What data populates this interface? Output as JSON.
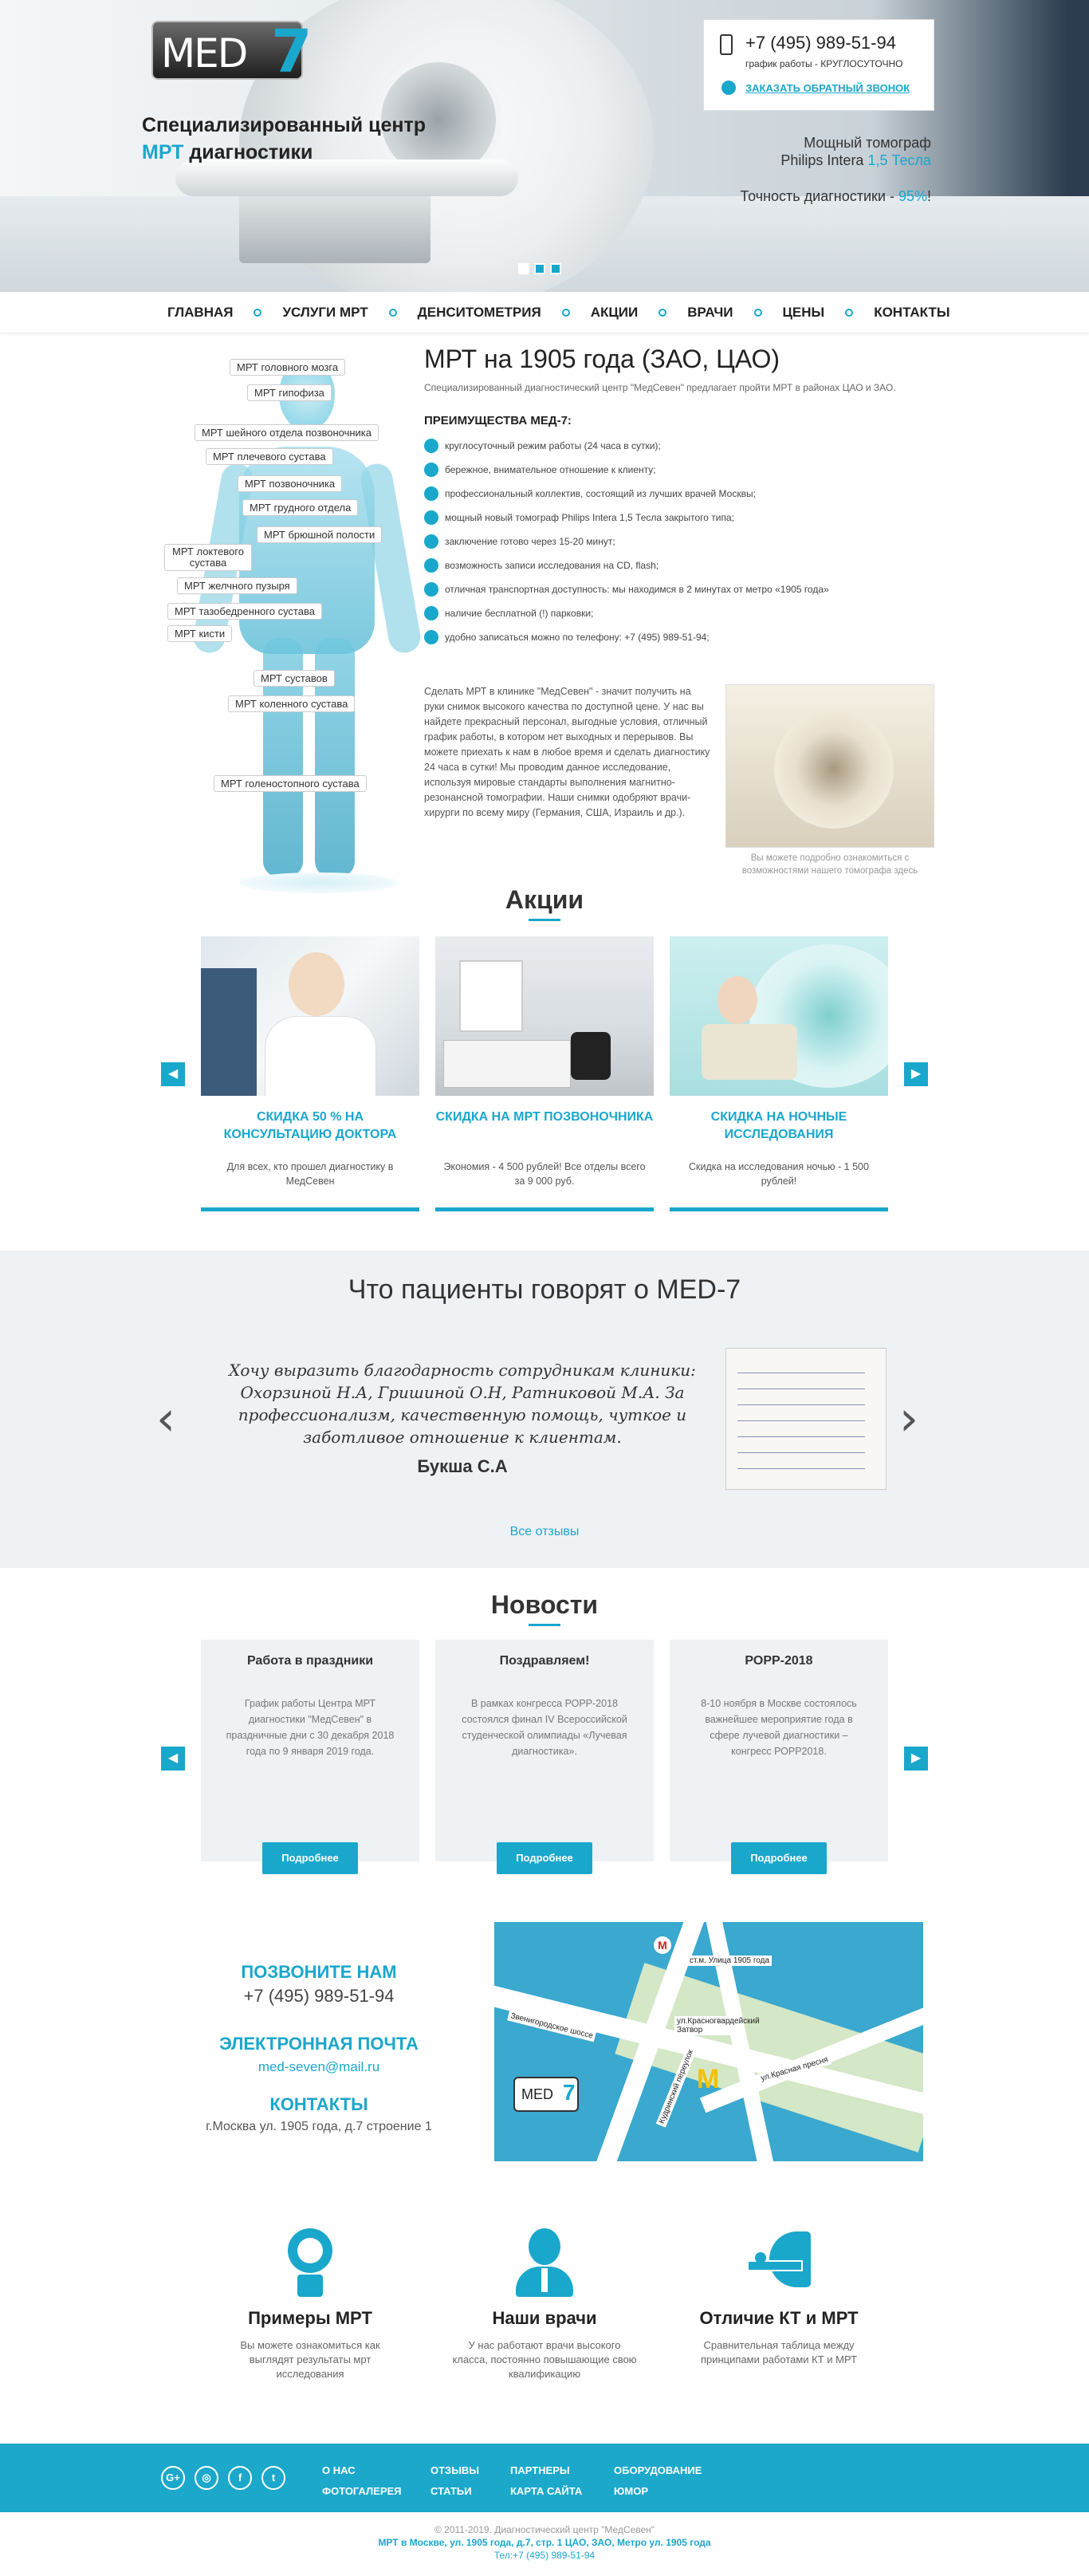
{
  "hero": {
    "logo_text": "MED",
    "logo_num": "7",
    "title_line1": "Специализированный центр",
    "title_accent": "МРТ",
    "title_line2_rest": " диагностики",
    "phone": "+7 (495) 989-51-94",
    "schedule": "график работы - КРУГЛОСУТОЧНО",
    "callback": "ЗАКАЗАТЬ ОБРАТНЫЙ ЗВОНОК",
    "tomograph_line1": "Мощный томограф",
    "tomograph_line2_model": "Philips Intera ",
    "tomograph_line2_accent": "1,5 Тесла",
    "accuracy_label": "Точность диагностики - ",
    "accuracy_value": "95%",
    "accuracy_suffix": "!"
  },
  "nav": [
    "ГЛАВНАЯ",
    "УСЛУГИ МРТ",
    "ДЕНСИТОМЕТРИЯ",
    "АКЦИИ",
    "ВРАЧИ",
    "ЦЕНЫ",
    "КОНТАКТЫ"
  ],
  "body_tags": [
    "МРТ головного мозга",
    "МРТ гипофиза",
    "МРТ шейного отдела позвоночника",
    "МРТ плечевого сустава",
    "МРТ позвоночника",
    "МРТ грудного отдела",
    "МРТ брюшной полости",
    "МРТ локтевого сустава",
    "МРТ желчного пузыря",
    "МРТ тазобедренного сустава",
    "МРТ кисти",
    "МРТ суставов",
    "МРТ коленного сустава",
    "МРТ голеностопного сустава"
  ],
  "intro": {
    "title": "МРТ на 1905 года (ЗАО, ЦАО)",
    "lead": "Специализированный диагностический центр \"МедСевен\" предлагает пройти МРТ в районах ЦАО и ЗАО.",
    "adv_title": "ПРЕИМУЩЕСТВА МЕД-7:",
    "advantages": [
      "круглосуточный режим работы (24 часа в сутки);",
      "бережное, внимательное отношение к клиенту;",
      "профессиональный коллектив, состоящий из лучших врачей Москвы;",
      "мощный новый томограф Philips Intera 1,5 Тесла закрытого типа;",
      "заключение готово через 15-20 минут;",
      "возможность записи исследования на CD, flash;",
      "отличная транспортная доступность: мы находимся в 2 минутах от метро «1905 года»",
      "наличие бесплатной (!) парковки;",
      "удобно записаться можно по телефону: +7 (495) 989-51-94;"
    ],
    "text": "Сделать МРТ в клинике \"МедСевен\" - значит получить на руки снимок высокого качества по доступной цене. У нас вы найдете прекрасный персонал, выгодные условия, отличный график работы, в котором нет выходных и перерывов. Вы можете приехать к нам в любое время и сделать диагностику 24 часа в сутки! Мы проводим данное исследование, используя мировые стандарты выполнения магнитно-резонансной томографии. Наши снимки одобряют врачи-хирурги по всему миру (Германия, США, Израиль и др.).",
    "caption": "Вы можете подробно ознакомиться с возможностями нашего томографа здесь"
  },
  "promos": {
    "title": "Акции",
    "items": [
      {
        "title": "СКИДКА 50 % НА КОНСУЛЬТАЦИЮ ДОКТОРА",
        "text": "Для всех, кто прошел диагностику в МедСевен"
      },
      {
        "title": "СКИДКА НА МРТ ПОЗВОНОЧНИКА",
        "text": "Экономия - 4 500 рублей! Все отделы всего за 9 000 руб."
      },
      {
        "title": "СКИДКА НА НОЧНЫЕ ИССЛЕДОВАНИЯ",
        "text": "Скидка на исследования ночью - 1 500 рублей!"
      }
    ]
  },
  "reviews": {
    "title": "Что пациенты говорят о MED-7",
    "quote": "Хочу выразить благодарность сотрудникам клиники: Охорзиной Н.А, Гришиной О.Н, Ратниковой М.А. За профессионализм, качественную помощь, чуткое и заботливое отношение к клиентам.",
    "author": "Букша С.А",
    "all_link": "Все отзывы"
  },
  "news": {
    "title": "Новости",
    "items": [
      {
        "title": "Работа в праздники",
        "text": "График работы Центра МРТ диагностики \"МедСевен\" в праздничные дни с 30 декабря 2018 года по 9 января 2019 года."
      },
      {
        "title": "Поздравляем!",
        "text": "В рамках конгресса РОРР-2018 состоялся финал IV Всероссийской студенческой олимпиады «Лучевая диагностика»."
      },
      {
        "title": "РОРР-2018",
        "text": "8-10 ноября в Москве состоялось важнейшее мероприятие года в сфере лучевой диагностики – конгресс РОРР2018."
      }
    ],
    "more": "Подробнее"
  },
  "contacts": {
    "call_label": "ПОЗВОНИТЕ НАМ",
    "phone": "+7 (495) 989-51-94",
    "email_label": "ЭЛЕКТРОННАЯ ПОЧТА",
    "email": "med-seven@mail.ru",
    "contacts_label": "КОНТАКТЫ",
    "address": "г.Москва ул. 1905 года, д.7 строение 1",
    "map_labels": [
      "ст.м. Улица 1905 года",
      "Звенигородское шоссе",
      "ул.Красногвардейский Затвор",
      "ул.Красная пресня",
      "Кудринский переулок"
    ],
    "map_logo": "MED"
  },
  "features": [
    {
      "title": "Примеры МРТ",
      "text": "Вы можете ознакомиться как выглядят результаты мрт исследования"
    },
    {
      "title": "Наши врачи",
      "text": "У нас работают врачи высокого класса, постоянно повышающие свою квалификацию"
    },
    {
      "title": "Отличие КТ и МРТ",
      "text": "Сравнительная таблица между принципами работами КТ и МРТ"
    }
  ],
  "footer": {
    "social": [
      "G+",
      "◎",
      "f",
      "t"
    ],
    "links": [
      "О НАС",
      "ФОТОГАЛЕРЕЯ",
      "ОТЗЫВЫ",
      "СТАТЬИ",
      "ПАРТНЕРЫ",
      "КАРТА САЙТА",
      "ОБОРУДОВАНИЕ",
      "ЮМОР"
    ],
    "copyright": "© 2011-2019. Диагностический центр \"МедСевен\"",
    "address": "МРТ в Москве, ул. 1905 года, д.7, стр. 1 ЦАО, ЗАО, Метро ул. 1905 года",
    "phone": "Тел:+7 (495) 989-51-94"
  },
  "colors": {
    "accent": "#1aa7cc",
    "footer": "#1ba8ca",
    "reviews_bg": "#eef2f5"
  }
}
